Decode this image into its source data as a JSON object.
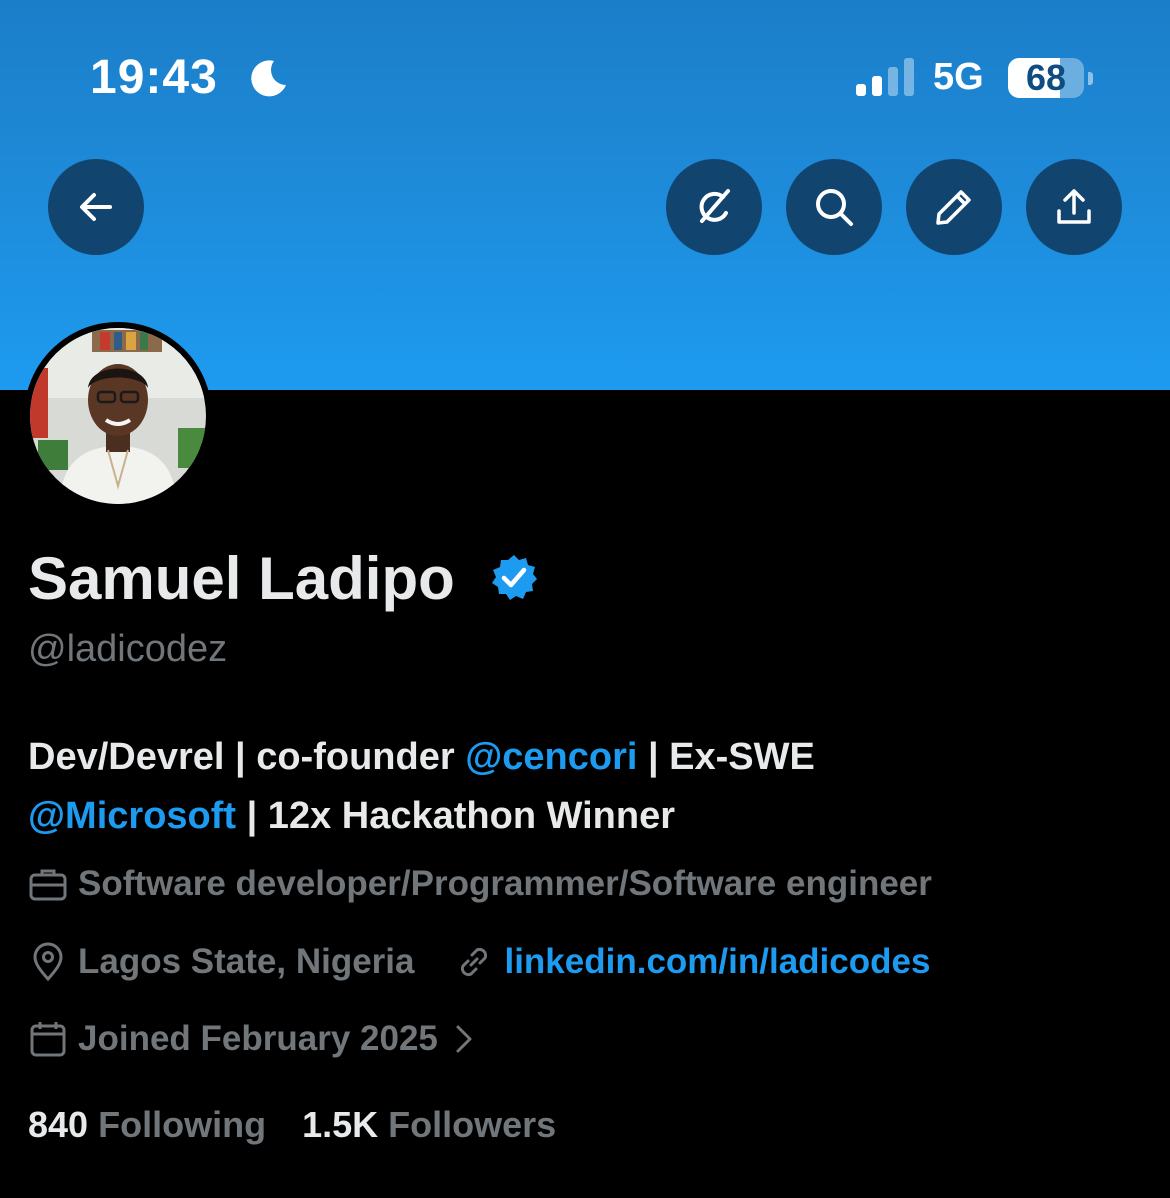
{
  "status_bar": {
    "time": "19:43",
    "network": "5G",
    "battery_percent": "68",
    "battery_level": 0.68
  },
  "toolbar": {
    "back_icon": "arrow-left-icon",
    "grok_icon": "grok-icon",
    "search_icon": "search-icon",
    "edit_icon": "pencil-icon",
    "share_icon": "share-icon"
  },
  "profile": {
    "display_name": "Samuel Ladipo",
    "verified": true,
    "handle": "@ladicodez",
    "bio": {
      "part1": "Dev/Devrel | co-founder ",
      "mention1": "@cencori",
      "part2": " | Ex-SWE",
      "mention2": "@Microsoft",
      "part3": " | 12x Hackathon Winner"
    },
    "profession": "Software developer/Programmer/Software engineer",
    "location": "Lagos State, Nigeria",
    "website": "linkedin.com/in/ladicodes",
    "joined": "Joined February 2025",
    "following_count": "840",
    "following_label": "Following",
    "followers_count": "1.5K",
    "followers_label": "Followers"
  },
  "colors": {
    "accent": "#1d9bf0",
    "muted": "#71767b",
    "text": "#e7e9ea",
    "background": "#000000"
  }
}
